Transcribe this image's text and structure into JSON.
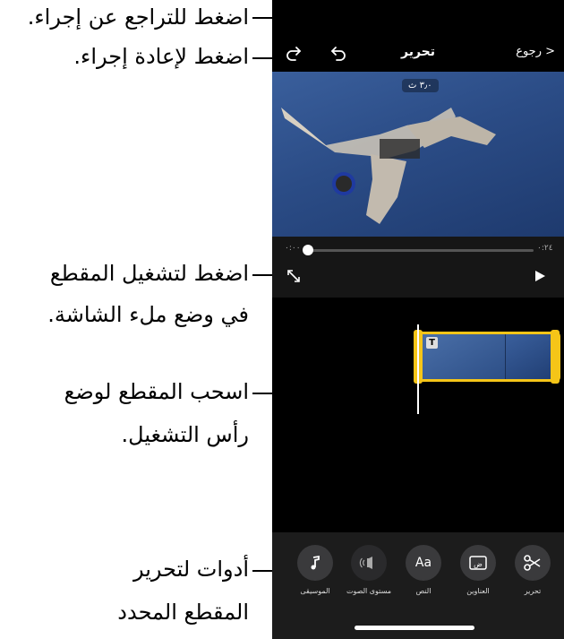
{
  "callouts": {
    "undo": "اضغط للتراجع عن إجراء.",
    "redo": "اضغط لإعادة إجراء.",
    "fullscreen_line1": "اضغط لتشغيل المقطع",
    "fullscreen_line2": "في وضع ملء الشاشة.",
    "drag_line1": "اسحب المقطع لوضع",
    "drag_line2": "رأس التشغيل.",
    "tools_line1": "أدوات لتحرير",
    "tools_line2": "المقطع المحدد"
  },
  "header": {
    "title": "تحرير",
    "back_label": "< رجوع"
  },
  "video": {
    "duration_badge": "٣٫٠ ث"
  },
  "playback": {
    "time_current": "٠:٠٠",
    "time_total": "٠:٢٤"
  },
  "toolbar": {
    "tools": [
      {
        "label": "تحرير",
        "icon": "scissors-icon"
      },
      {
        "label": "العناوين",
        "icon": "titles-icon"
      },
      {
        "label": "النص",
        "icon": "text-icon",
        "glyph": "Aa"
      },
      {
        "label": "مستوى الصوت",
        "icon": "volume-icon"
      },
      {
        "label": "الموسيقى",
        "icon": "music-note-icon"
      }
    ]
  },
  "colors": {
    "clip_border": "#f5c518",
    "screen_bg": "#000000",
    "toolbar_bg": "#1c1c1c"
  }
}
